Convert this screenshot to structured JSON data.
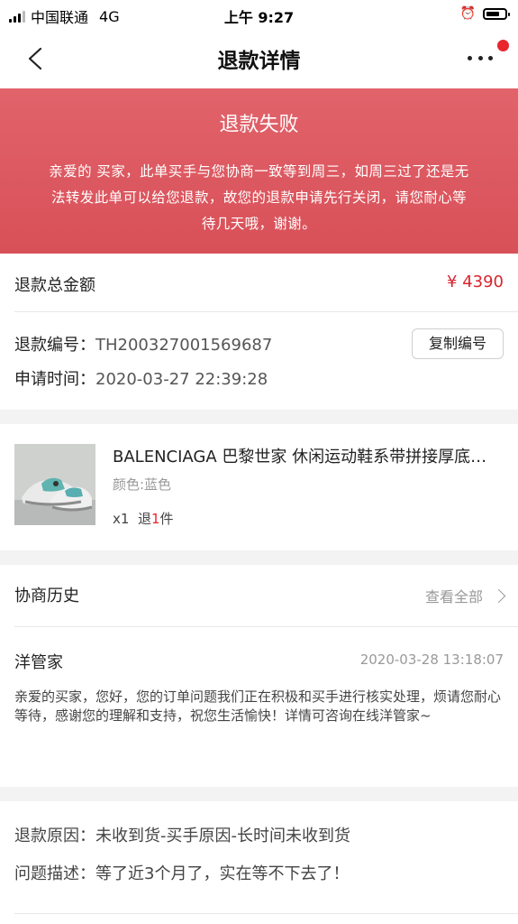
{
  "status_bar": {
    "carrier": "中国联通",
    "network": "4G",
    "time": "上午 9:27",
    "icons": [
      "signal-icon",
      "alarm-icon",
      "battery-icon"
    ]
  },
  "nav": {
    "title": "退款详情",
    "back_icon": "chevron-left-icon",
    "more_icon": "more-dots-icon",
    "badge_color": "#e8262c"
  },
  "banner": {
    "title": "退款失败",
    "message": "亲爱的 买家，此单买手与您协商一致等到周三，如周三过了还是无法转发此单可以给您退款，故您的退款申请先行关闭，请您耐心等待几天哦，谢谢。",
    "bg_color": "#e0606a"
  },
  "amount": {
    "label": "退款总金额",
    "value": "¥ 4390",
    "color": "#d8262e"
  },
  "refund_info": {
    "number_label": "退款编号：",
    "number_value": "TH200327001569687",
    "copy_button": "复制编号",
    "time_label": "申请时间：",
    "time_value": "2020-03-27 22:39:28"
  },
  "product": {
    "name": "BALENCIAGA 巴黎世家 休闲运动鞋系带拼接厚底老爹鞋",
    "color": "颜色:蓝色",
    "qty_prefix": "x1  退",
    "qty_num": "1",
    "qty_suffix": "件",
    "image": "sneaker-product-image"
  },
  "history": {
    "title": "协商历史",
    "view_all": "查看全部",
    "sender": "洋管家",
    "time": "2020-03-28 13:18:07",
    "body": "亲爱的买家，您好，您的订单问题我们正在积极和买手进行核实处理，烦请您耐心等待，感谢您的理解和支持，祝您生活愉快！详情可咨询在线洋管家~"
  },
  "reason": {
    "reason_label": "退款原因：",
    "reason_value": "未收到货-买手原因-长时间未收到货",
    "desc_label": "问题描述：",
    "desc_value": "等了近3个月了，实在等不下去了！"
  }
}
